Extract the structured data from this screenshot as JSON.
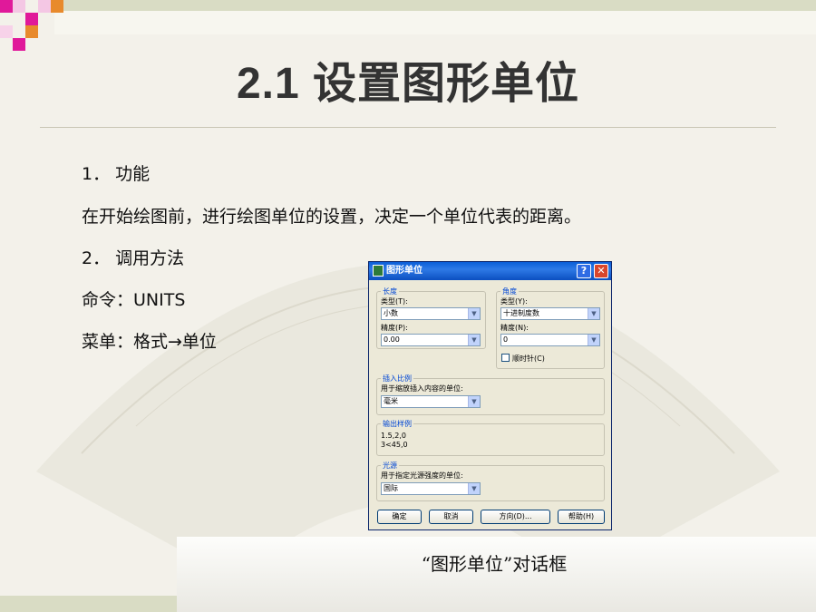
{
  "slide": {
    "title": "2.1 设置图形单位",
    "lines": [
      "1．  功能",
      "在开始绘图前，进行绘图单位的设置，决定一个单位代表的距离。",
      "2．  调用方法",
      "命令：UNITS",
      "菜单：格式→单位"
    ],
    "caption": "“图形单位”对话框"
  },
  "dialog": {
    "title": "图形单位",
    "help_label": "?",
    "close_label": "✕",
    "length": {
      "group_label": "长度",
      "type_label": "类型(T):",
      "type_value": "小数",
      "precision_label": "精度(P):",
      "precision_value": "0.00"
    },
    "angle": {
      "group_label": "角度",
      "type_label": "类型(Y):",
      "type_value": "十进制度数",
      "precision_label": "精度(N):",
      "precision_value": "0",
      "clockwise_label": "顺时针(C)"
    },
    "insert_scale": {
      "group_label": "插入比例",
      "desc": "用于缩放插入内容的单位:",
      "value": "毫米"
    },
    "sample": {
      "group_label": "输出样例",
      "line1": "1.5,2,0",
      "line2": "3<45,0"
    },
    "lighting": {
      "group_label": "光源",
      "desc": "用于指定光源强度的单位:",
      "value": "国际"
    },
    "buttons": {
      "ok": "确定",
      "cancel": "取消",
      "direction": "方向(D)...",
      "help": "帮助(H)"
    }
  },
  "colors": {
    "accent_magenta": "#e0199a",
    "accent_orange": "#e88a2c",
    "title_text": "#333333"
  }
}
